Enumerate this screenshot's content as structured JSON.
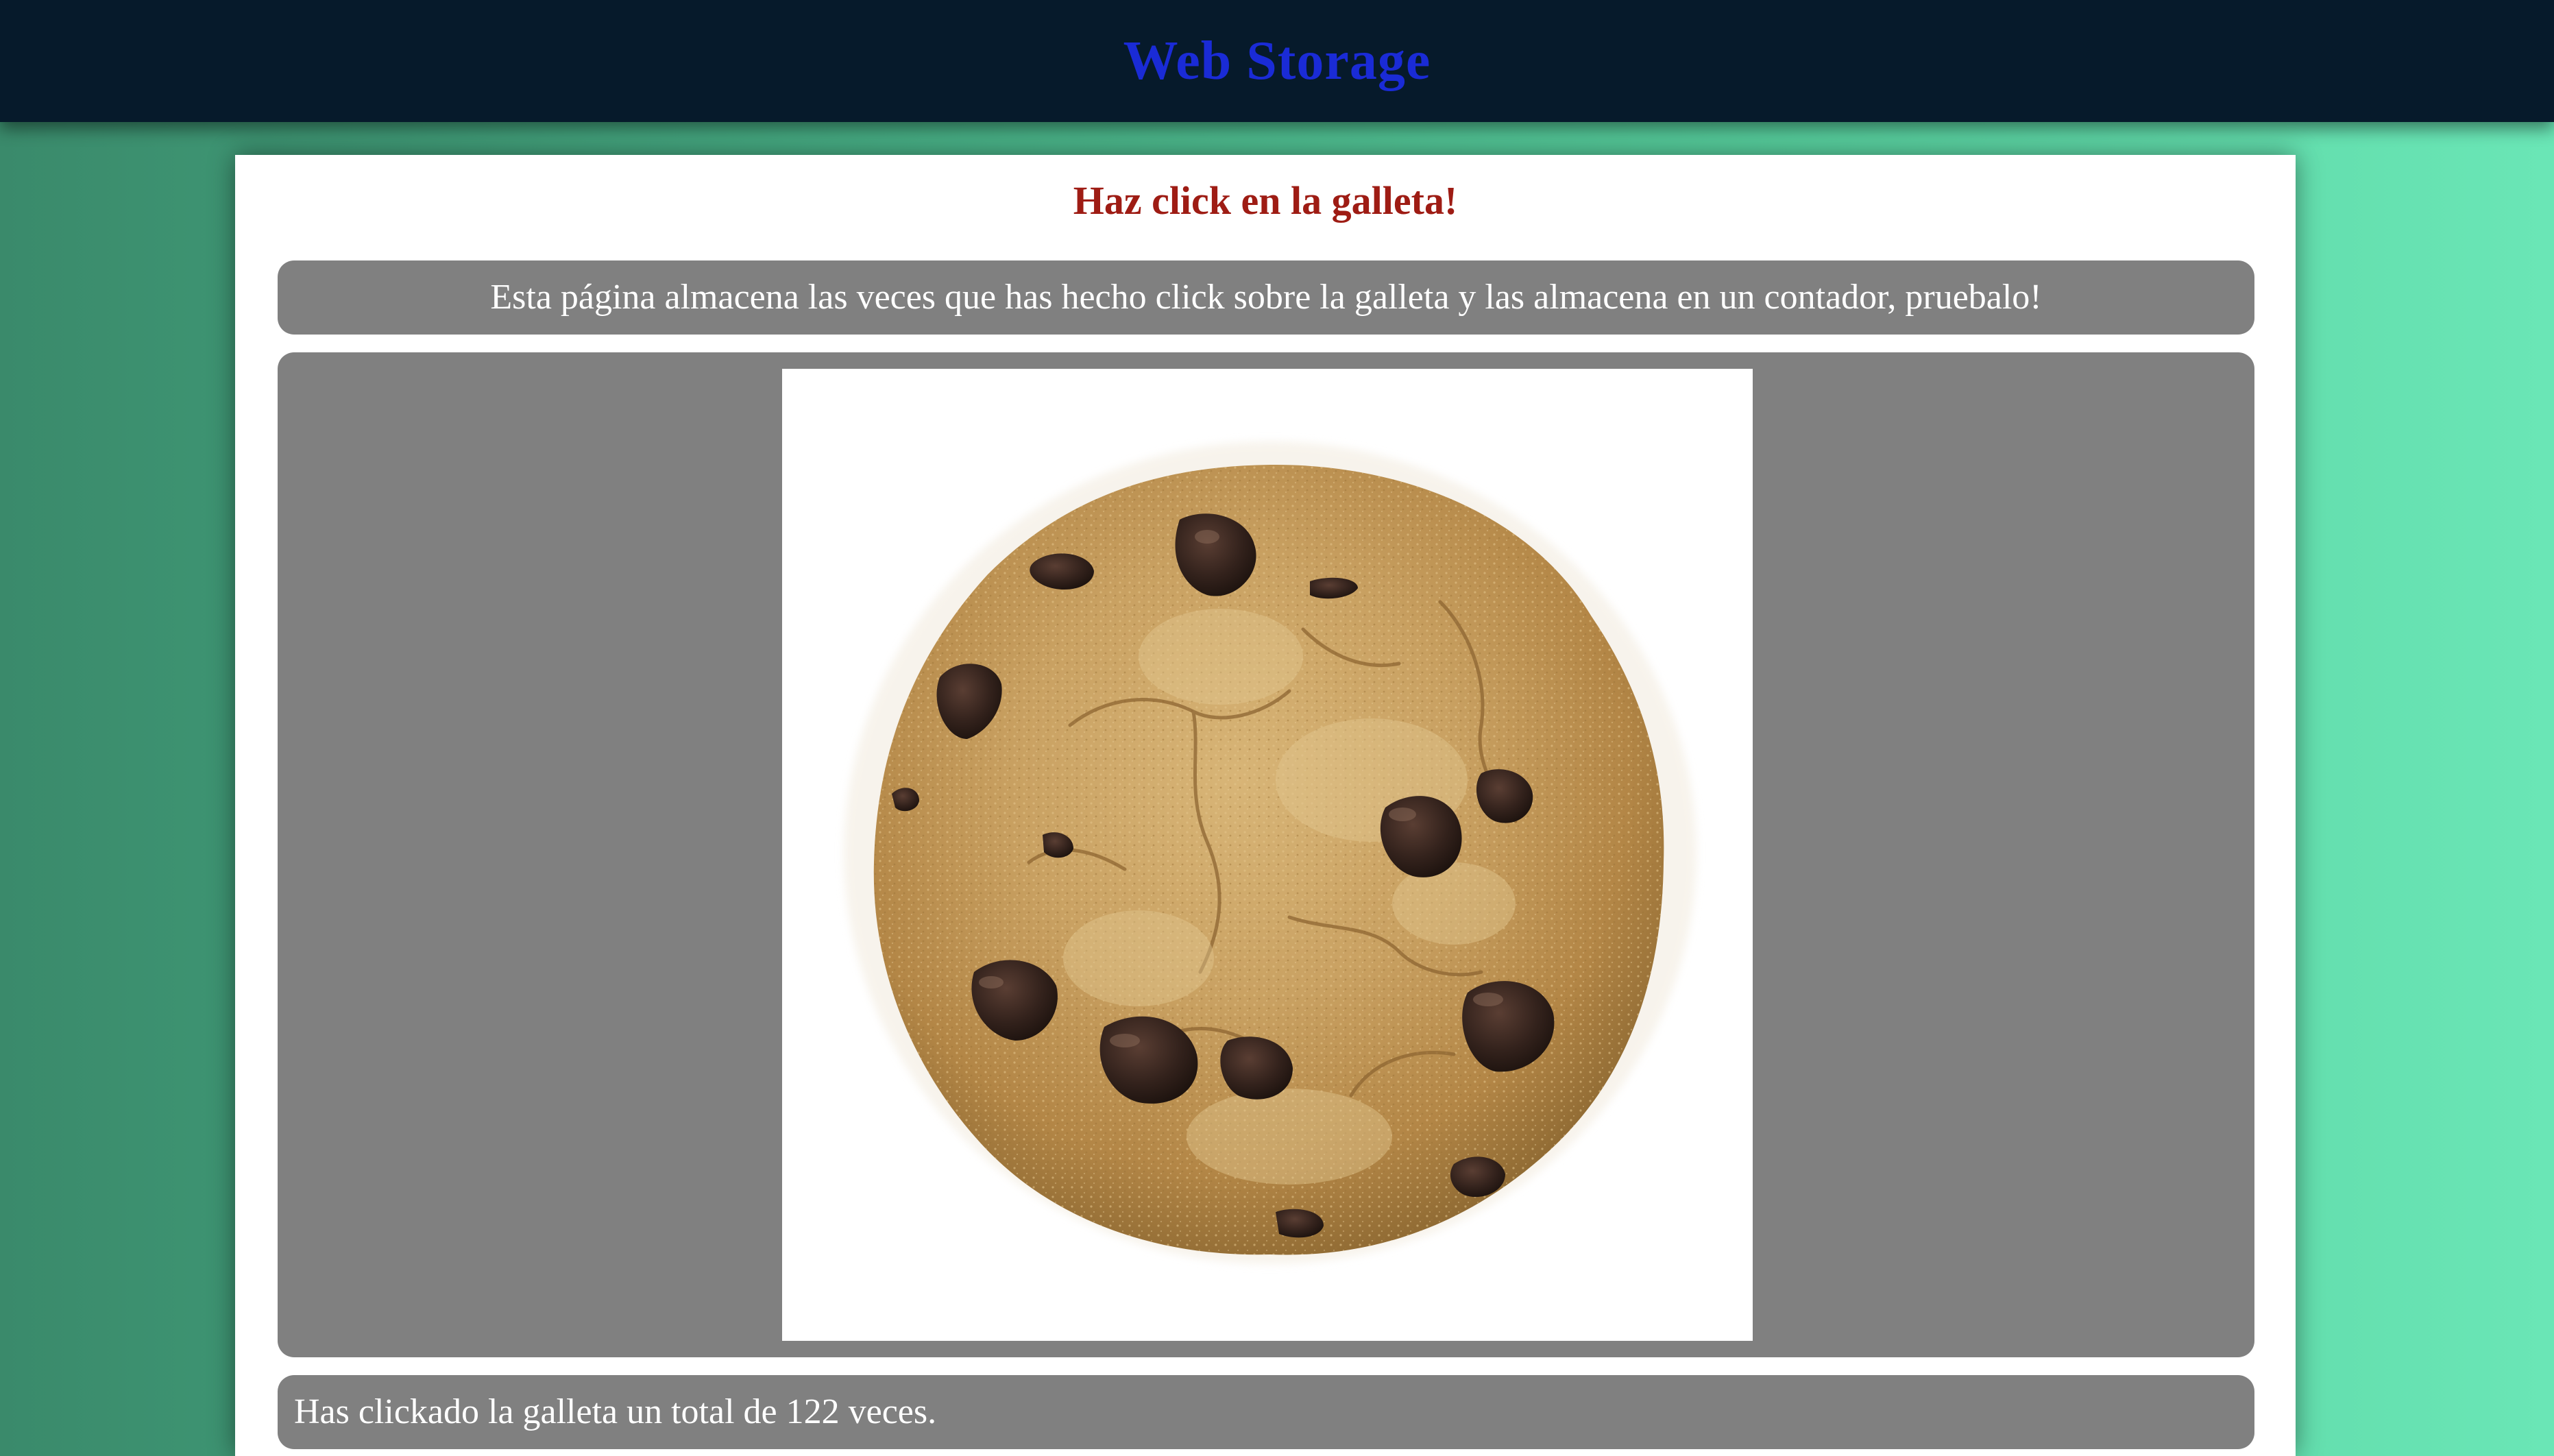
{
  "header": {
    "title": "Web Storage",
    "title_color": "#1a2bd6",
    "background_color": "#061a2b"
  },
  "main": {
    "heading": "Haz click en la galleta!",
    "heading_color": "#9e1c14",
    "description": "Esta página almacena las veces que has hecho click sobre la galleta y las almacena en un contador, pruebalo!",
    "image": {
      "icon": "chocolate-chip-cookie",
      "alt": "galleta"
    },
    "counter_text": "Has clickado la galleta un total de 122 veces.",
    "panel_color": "#808080"
  }
}
